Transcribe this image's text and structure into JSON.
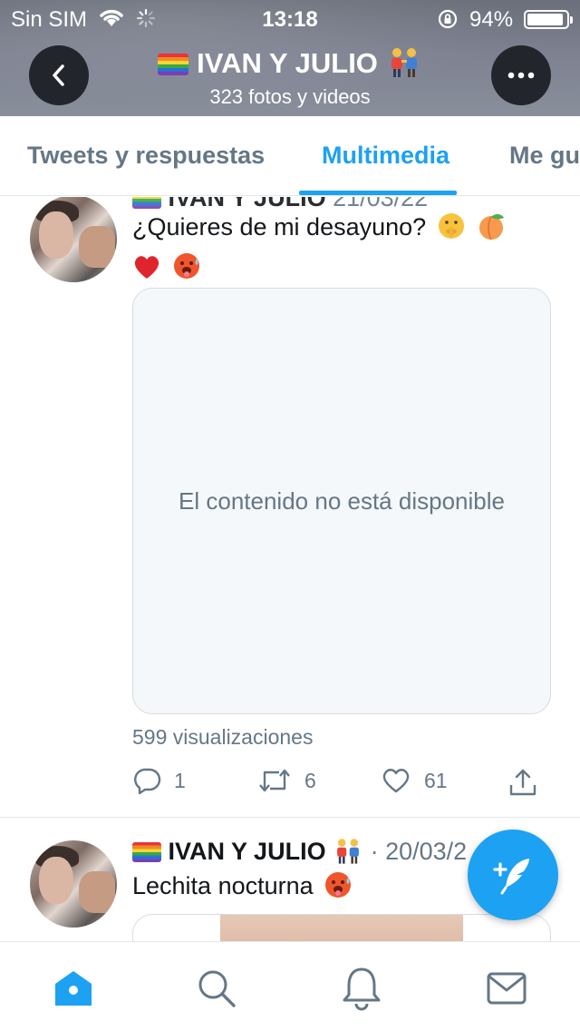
{
  "status_bar": {
    "carrier": "Sin SIM",
    "time": "13:18",
    "battery_percent": "94%",
    "battery_level": 0.94
  },
  "profile_header": {
    "name": "IVAN Y JULIO",
    "subtitle": "323 fotos y videos"
  },
  "tabs": [
    {
      "label": "Tweets y respuestas",
      "active": false
    },
    {
      "label": "Multimedia",
      "active": true
    },
    {
      "label": "Me gu",
      "active": false
    }
  ],
  "tweets": [
    {
      "author_partial": "IVAN Y JULIO",
      "date_partial": "21/03/22",
      "text": "¿Quieres de mi desayuno?",
      "media_unavailable": "El contenido no está disponible",
      "views": "599 visualizaciones",
      "replies": "1",
      "retweets": "6",
      "likes": "61"
    },
    {
      "author": "IVAN Y JULIO",
      "date": "· 20/03/2",
      "text": "Lechita nocturna"
    }
  ],
  "icons": {
    "back": "chevron-left-icon",
    "more": "more-icon",
    "reply": "reply-icon",
    "retweet": "retweet-icon",
    "like": "heart-icon",
    "share": "share-icon",
    "compose": "compose-icon",
    "home": "home-icon",
    "search": "search-icon",
    "notifications": "bell-icon",
    "messages": "mail-icon"
  },
  "colors": {
    "accent": "#1da1f2",
    "secondary_text": "#657786",
    "border": "#e1e8ed"
  }
}
